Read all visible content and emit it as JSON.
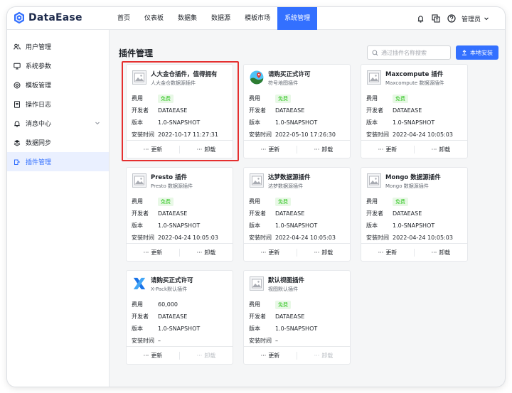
{
  "app": {
    "name": "DataEase"
  },
  "nav": {
    "items": [
      {
        "label": "首页",
        "active": false
      },
      {
        "label": "仪表板",
        "active": false
      },
      {
        "label": "数据集",
        "active": false
      },
      {
        "label": "数据源",
        "active": false
      },
      {
        "label": "模板市场",
        "active": false
      },
      {
        "label": "系统管理",
        "active": true
      }
    ]
  },
  "header": {
    "user": "管理员"
  },
  "sidebar": {
    "items": [
      {
        "label": "用户管理",
        "icon": "users-icon"
      },
      {
        "label": "系统参数",
        "icon": "monitor-icon"
      },
      {
        "label": "模板管理",
        "icon": "template-icon"
      },
      {
        "label": "操作日志",
        "icon": "log-icon"
      },
      {
        "label": "消息中心",
        "icon": "bell-icon"
      },
      {
        "label": "数据同步",
        "icon": "sync-icon"
      },
      {
        "label": "插件管理",
        "icon": "plugin-icon"
      }
    ]
  },
  "page": {
    "title": "插件管理",
    "search_placeholder": "通过插件名称搜索",
    "install_label": "本地安装"
  },
  "labels": {
    "fee": "费用",
    "developer": "开发者",
    "version": "版本",
    "install_time": "安装时间",
    "update": "更新",
    "uninstall": "卸载"
  },
  "plugins": [
    {
      "name": "人大金仓插件，值得拥有",
      "desc": "人大金仓数据源插件",
      "fee": "免费",
      "developer": "DATAEASE",
      "version": "1.0-SNAPSHOT",
      "install_time": "2022-10-17 11:27:31",
      "icon": "image-placeholder-icon",
      "uninstall_disabled": false
    },
    {
      "name": "请购买正式许可",
      "desc": "符号地图插件",
      "fee": "免费",
      "developer": "DATAEASE",
      "version": "1.0-SNAPSHOT",
      "install_time": "2022-05-10 17:26:30",
      "icon": "map-icon",
      "uninstall_disabled": false
    },
    {
      "name": "Maxcompute 插件",
      "desc": "Maxcompute 数据源插件",
      "fee": "免费",
      "developer": "DATAEASE",
      "version": "1.0-SNAPSHOT",
      "install_time": "2022-04-24 10:05:03",
      "icon": "image-placeholder-icon",
      "uninstall_disabled": false
    },
    {
      "name": "Presto 插件",
      "desc": "Presto 数据源插件",
      "fee": "免费",
      "developer": "DATAEASE",
      "version": "1.0-SNAPSHOT",
      "install_time": "2022-04-24 10:05:03",
      "icon": "image-placeholder-icon",
      "uninstall_disabled": false
    },
    {
      "name": "达梦数据源插件",
      "desc": "达梦数据源插件",
      "fee": "免费",
      "developer": "DATAEASE",
      "version": "1.0-SNAPSHOT",
      "install_time": "2022-04-24 10:05:03",
      "icon": "image-placeholder-icon",
      "uninstall_disabled": false
    },
    {
      "name": "Mongo 数据源插件",
      "desc": "Mongo 数据源插件",
      "fee": "免费",
      "developer": "DATAEASE",
      "version": "1.0-SNAPSHOT",
      "install_time": "2022-04-24 10:05:03",
      "icon": "image-placeholder-icon",
      "uninstall_disabled": false
    },
    {
      "name": "请购买正式许可",
      "desc": "X-Pack默认插件",
      "fee": "60,000",
      "developer": "DATAEASE",
      "version": "1.0-SNAPSHOT",
      "install_time": "–",
      "icon": "xpack-icon",
      "uninstall_disabled": true
    },
    {
      "name": "默认视图插件",
      "desc": "视图默认插件",
      "fee": "免费",
      "developer": "DATAEASE",
      "version": "1.0-SNAPSHOT",
      "install_time": "–",
      "icon": "image-placeholder-icon",
      "uninstall_disabled": true
    }
  ],
  "colors": {
    "accent": "#3370ff",
    "free_tag": "#34c724",
    "highlight": "#e52f2f"
  }
}
